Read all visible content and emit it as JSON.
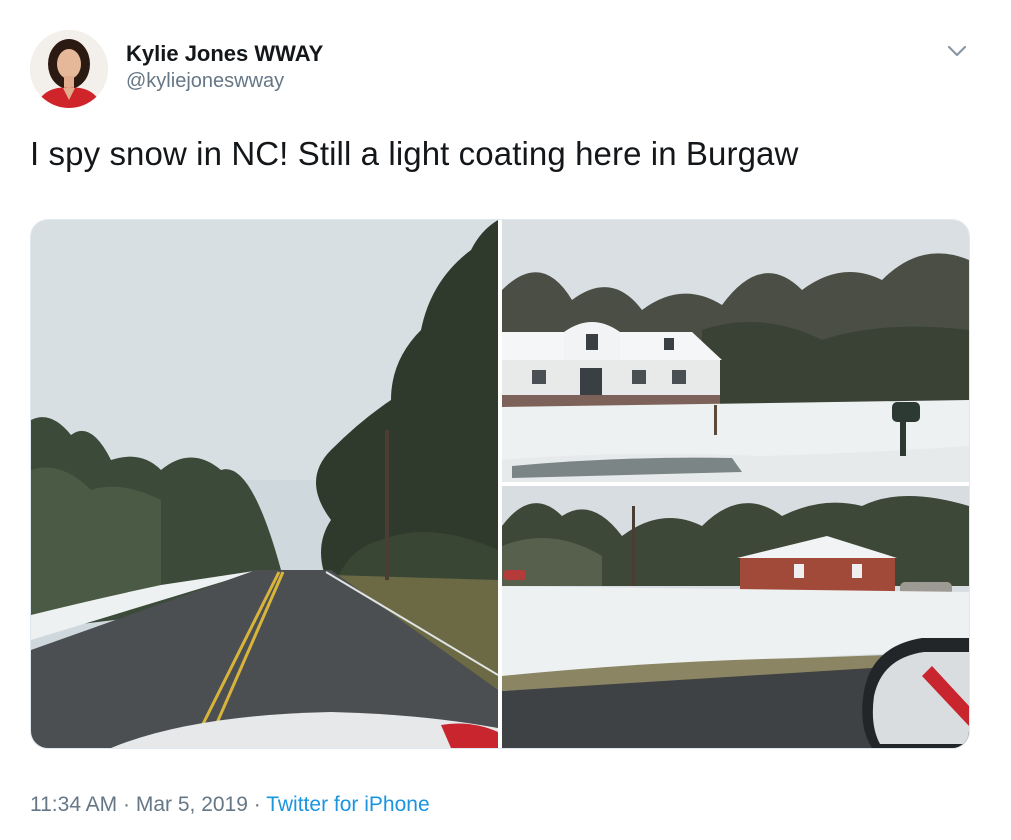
{
  "author": {
    "display_name": "Kylie Jones WWAY",
    "handle": "@kyliejoneswway"
  },
  "tweet": {
    "text": "I spy snow in NC! Still a light coating here in Burgaw"
  },
  "media": [
    {
      "subject": "snowy road lined with trees"
    },
    {
      "subject": "white farmhouse with snow-covered lawn"
    },
    {
      "subject": "brick house with snowy lawn viewed from car"
    }
  ],
  "meta": {
    "time": "11:34 AM",
    "separator": " · ",
    "date": "Mar 5, 2019",
    "source": "Twitter for iPhone"
  },
  "icons": {
    "menu": "chevron-down-icon"
  },
  "colors": {
    "link": "#1b95e0",
    "secondary_text": "#657786",
    "primary_text": "#14171a"
  }
}
